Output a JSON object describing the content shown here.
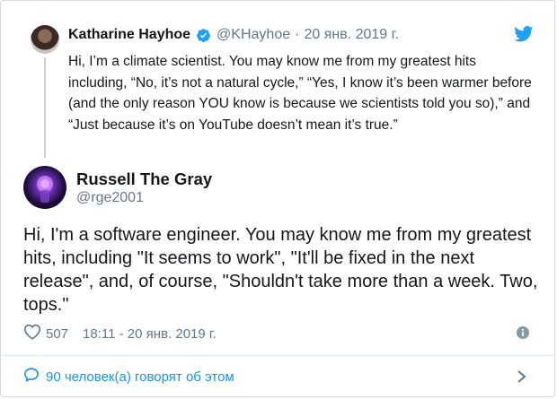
{
  "quoted_tweet": {
    "author_name": "Katharine Hayhoe",
    "handle": "@KHayhoe",
    "separator": "·",
    "date": "20 янв. 2019 г.",
    "text": "Hi, I’m a climate scientist. You may know me from my greatest hits including, “No, it’s not a natural cycle,” “Yes, I know it’s been warmer before (and the only reason YOU know is because we scientists told you so),” and “Just because it’s on YouTube doesn’t mean it’s true.”"
  },
  "main_tweet": {
    "author_name": "Russell The Gray",
    "handle": "@rge2001",
    "text": "Hi, I'm a software engineer. You may know me from my greatest hits, including \"It seems to work\", \"It'll be fixed in the next release\", and, of course, \"Shouldn't take more than a week. Two, tops.\"",
    "likes": "507",
    "timestamp": "18:11 - 20 янв. 2019 г."
  },
  "conversation": {
    "label": "90 человек(а) говорят об этом"
  },
  "colors": {
    "link": "#1b95e0",
    "secondary_text": "#657786",
    "verified": "#1da1f2"
  }
}
